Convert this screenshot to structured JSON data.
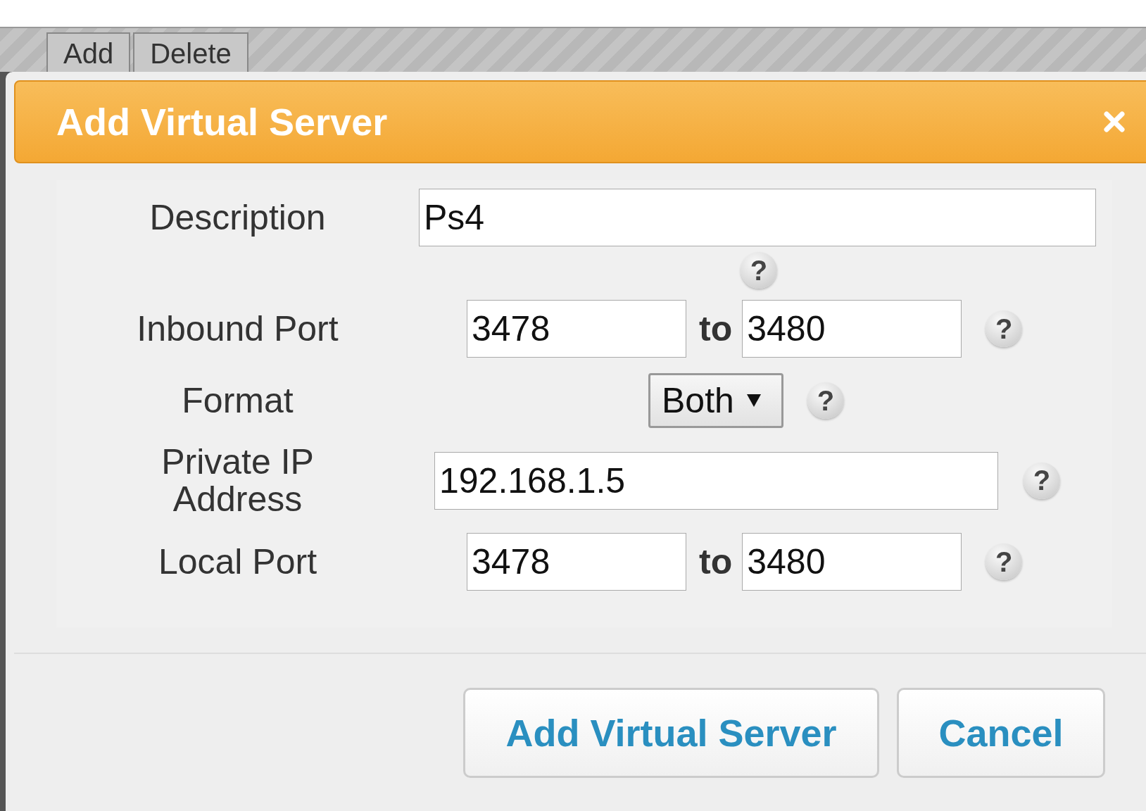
{
  "tabs": [
    {
      "label": "Add"
    },
    {
      "label": "Delete"
    }
  ],
  "dialog": {
    "title": "Add Virtual Server",
    "fields": [
      {
        "kind": "text",
        "label": "Description",
        "value": "Ps4",
        "help": "?"
      },
      {
        "kind": "range",
        "label": "Inbound Port",
        "from": "3478",
        "separator": "to",
        "to": "3480",
        "help": "?"
      },
      {
        "kind": "select",
        "label": "Format",
        "value": "Both",
        "help": "?"
      },
      {
        "kind": "ip",
        "label": "Private IP Address",
        "value": "192.168.1.5",
        "help": "?"
      },
      {
        "kind": "range",
        "label": "Local Port",
        "from": "3478",
        "separator": "to",
        "to": "3480",
        "help": "?"
      }
    ],
    "buttons": [
      {
        "label": "Add Virtual Server"
      },
      {
        "label": "Cancel"
      }
    ]
  }
}
